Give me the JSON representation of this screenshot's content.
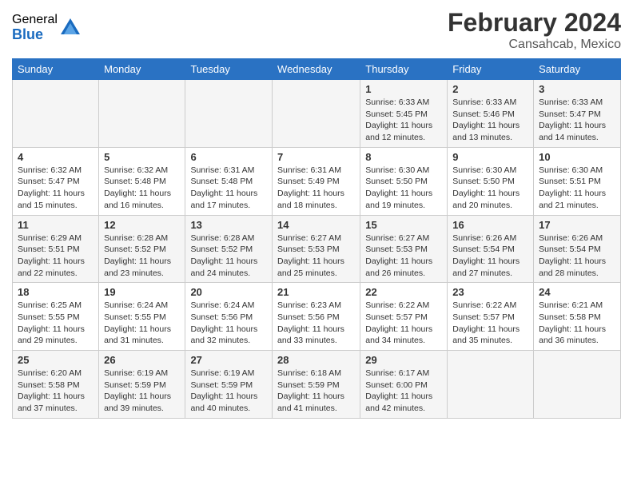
{
  "logo": {
    "general": "General",
    "blue": "Blue"
  },
  "title": "February 2024",
  "subtitle": "Cansahcab, Mexico",
  "header_days": [
    "Sunday",
    "Monday",
    "Tuesday",
    "Wednesday",
    "Thursday",
    "Friday",
    "Saturday"
  ],
  "weeks": [
    [
      {
        "num": "",
        "info": ""
      },
      {
        "num": "",
        "info": ""
      },
      {
        "num": "",
        "info": ""
      },
      {
        "num": "",
        "info": ""
      },
      {
        "num": "1",
        "info": "Sunrise: 6:33 AM\nSunset: 5:45 PM\nDaylight: 11 hours and 12 minutes."
      },
      {
        "num": "2",
        "info": "Sunrise: 6:33 AM\nSunset: 5:46 PM\nDaylight: 11 hours and 13 minutes."
      },
      {
        "num": "3",
        "info": "Sunrise: 6:33 AM\nSunset: 5:47 PM\nDaylight: 11 hours and 14 minutes."
      }
    ],
    [
      {
        "num": "4",
        "info": "Sunrise: 6:32 AM\nSunset: 5:47 PM\nDaylight: 11 hours and 15 minutes."
      },
      {
        "num": "5",
        "info": "Sunrise: 6:32 AM\nSunset: 5:48 PM\nDaylight: 11 hours and 16 minutes."
      },
      {
        "num": "6",
        "info": "Sunrise: 6:31 AM\nSunset: 5:48 PM\nDaylight: 11 hours and 17 minutes."
      },
      {
        "num": "7",
        "info": "Sunrise: 6:31 AM\nSunset: 5:49 PM\nDaylight: 11 hours and 18 minutes."
      },
      {
        "num": "8",
        "info": "Sunrise: 6:30 AM\nSunset: 5:50 PM\nDaylight: 11 hours and 19 minutes."
      },
      {
        "num": "9",
        "info": "Sunrise: 6:30 AM\nSunset: 5:50 PM\nDaylight: 11 hours and 20 minutes."
      },
      {
        "num": "10",
        "info": "Sunrise: 6:30 AM\nSunset: 5:51 PM\nDaylight: 11 hours and 21 minutes."
      }
    ],
    [
      {
        "num": "11",
        "info": "Sunrise: 6:29 AM\nSunset: 5:51 PM\nDaylight: 11 hours and 22 minutes."
      },
      {
        "num": "12",
        "info": "Sunrise: 6:28 AM\nSunset: 5:52 PM\nDaylight: 11 hours and 23 minutes."
      },
      {
        "num": "13",
        "info": "Sunrise: 6:28 AM\nSunset: 5:52 PM\nDaylight: 11 hours and 24 minutes."
      },
      {
        "num": "14",
        "info": "Sunrise: 6:27 AM\nSunset: 5:53 PM\nDaylight: 11 hours and 25 minutes."
      },
      {
        "num": "15",
        "info": "Sunrise: 6:27 AM\nSunset: 5:53 PM\nDaylight: 11 hours and 26 minutes."
      },
      {
        "num": "16",
        "info": "Sunrise: 6:26 AM\nSunset: 5:54 PM\nDaylight: 11 hours and 27 minutes."
      },
      {
        "num": "17",
        "info": "Sunrise: 6:26 AM\nSunset: 5:54 PM\nDaylight: 11 hours and 28 minutes."
      }
    ],
    [
      {
        "num": "18",
        "info": "Sunrise: 6:25 AM\nSunset: 5:55 PM\nDaylight: 11 hours and 29 minutes."
      },
      {
        "num": "19",
        "info": "Sunrise: 6:24 AM\nSunset: 5:55 PM\nDaylight: 11 hours and 31 minutes."
      },
      {
        "num": "20",
        "info": "Sunrise: 6:24 AM\nSunset: 5:56 PM\nDaylight: 11 hours and 32 minutes."
      },
      {
        "num": "21",
        "info": "Sunrise: 6:23 AM\nSunset: 5:56 PM\nDaylight: 11 hours and 33 minutes."
      },
      {
        "num": "22",
        "info": "Sunrise: 6:22 AM\nSunset: 5:57 PM\nDaylight: 11 hours and 34 minutes."
      },
      {
        "num": "23",
        "info": "Sunrise: 6:22 AM\nSunset: 5:57 PM\nDaylight: 11 hours and 35 minutes."
      },
      {
        "num": "24",
        "info": "Sunrise: 6:21 AM\nSunset: 5:58 PM\nDaylight: 11 hours and 36 minutes."
      }
    ],
    [
      {
        "num": "25",
        "info": "Sunrise: 6:20 AM\nSunset: 5:58 PM\nDaylight: 11 hours and 37 minutes."
      },
      {
        "num": "26",
        "info": "Sunrise: 6:19 AM\nSunset: 5:59 PM\nDaylight: 11 hours and 39 minutes."
      },
      {
        "num": "27",
        "info": "Sunrise: 6:19 AM\nSunset: 5:59 PM\nDaylight: 11 hours and 40 minutes."
      },
      {
        "num": "28",
        "info": "Sunrise: 6:18 AM\nSunset: 5:59 PM\nDaylight: 11 hours and 41 minutes."
      },
      {
        "num": "29",
        "info": "Sunrise: 6:17 AM\nSunset: 6:00 PM\nDaylight: 11 hours and 42 minutes."
      },
      {
        "num": "",
        "info": ""
      },
      {
        "num": "",
        "info": ""
      }
    ]
  ]
}
